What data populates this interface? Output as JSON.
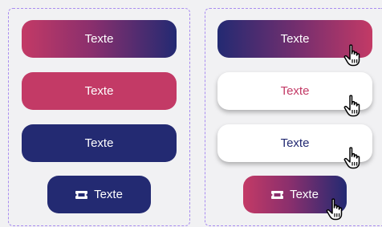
{
  "left": {
    "gradient_button": "Texte",
    "pink_button": "Texte",
    "navy_button": "Texte",
    "ticket_button": "Texte"
  },
  "right": {
    "gradient_button": "Texte",
    "white_pink_button": "Texte",
    "white_navy_button": "Texte",
    "ticket_button": "Texte"
  },
  "colors": {
    "pink": "#c33a66",
    "navy": "#232a72",
    "panel_border": "#a98cf0",
    "background": "#f1f1f3"
  },
  "icons": {
    "ticket": "ticket-icon",
    "cursor": "hand-pointer-icon"
  }
}
